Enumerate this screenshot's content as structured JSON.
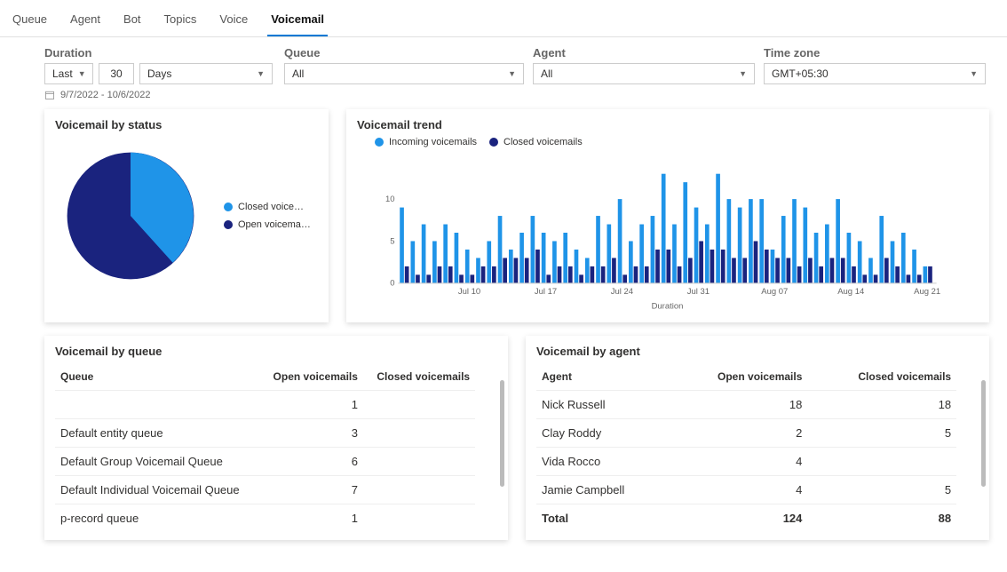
{
  "tabs": [
    "Queue",
    "Agent",
    "Bot",
    "Topics",
    "Voice",
    "Voicemail"
  ],
  "active_tab": 5,
  "filters": {
    "duration": {
      "label": "Duration",
      "mode": "Last",
      "value": "30",
      "unit": "Days"
    },
    "queue": {
      "label": "Queue",
      "value": "All"
    },
    "agent": {
      "label": "Agent",
      "value": "All"
    },
    "timezone": {
      "label": "Time zone",
      "value": "GMT+05:30"
    },
    "date_range": "9/7/2022 - 10/6/2022"
  },
  "pie": {
    "title": "Voicemail by status",
    "legend": {
      "closed": "Closed voice…",
      "open": "Open voicema…"
    }
  },
  "trend": {
    "title": "Voicemail trend",
    "legend": {
      "incoming": "Incoming voicemails",
      "closed": "Closed voicemails"
    },
    "xlabel": "Duration"
  },
  "queue_card": {
    "title": "Voicemail by queue",
    "cols": {
      "queue": "Queue",
      "open": "Open voicemails",
      "closed": "Closed voicemails"
    },
    "rows": [
      {
        "queue": "",
        "open": "1",
        "closed": ""
      },
      {
        "queue": "Default entity queue",
        "open": "3",
        "closed": ""
      },
      {
        "queue": "Default Group Voicemail Queue",
        "open": "6",
        "closed": ""
      },
      {
        "queue": "Default Individual Voicemail Queue",
        "open": "7",
        "closed": ""
      },
      {
        "queue": "p-record queue",
        "open": "1",
        "closed": ""
      }
    ]
  },
  "agent_card": {
    "title": "Voicemail by agent",
    "cols": {
      "agent": "Agent",
      "open": "Open voicemails",
      "closed": "Closed voicemails"
    },
    "rows": [
      {
        "agent": "Nick Russell",
        "open": "18",
        "closed": "18"
      },
      {
        "agent": "Clay Roddy",
        "open": "2",
        "closed": "5"
      },
      {
        "agent": "Vida Rocco",
        "open": "4",
        "closed": ""
      },
      {
        "agent": "Jamie Campbell",
        "open": "4",
        "closed": "5"
      }
    ],
    "total": {
      "label": "Total",
      "open": "124",
      "closed": "88"
    }
  },
  "chart_data": [
    {
      "type": "pie",
      "title": "Voicemail by status",
      "series": [
        {
          "name": "Closed voicemails",
          "value": 41,
          "color": "#1f94e8"
        },
        {
          "name": "Open voicemails",
          "value": 59,
          "color": "#1a237e"
        }
      ]
    },
    {
      "type": "bar",
      "title": "Voicemail trend",
      "xlabel": "Duration",
      "ylabel": "",
      "ylim": [
        0,
        14
      ],
      "yticks": [
        0,
        5,
        10
      ],
      "categories": [
        "Jul 04",
        "Jul 05",
        "Jul 06",
        "Jul 07",
        "Jul 08",
        "Jul 09",
        "Jul 10",
        "Jul 11",
        "Jul 12",
        "Jul 13",
        "Jul 14",
        "Jul 15",
        "Jul 16",
        "Jul 17",
        "Jul 18",
        "Jul 19",
        "Jul 20",
        "Jul 21",
        "Jul 22",
        "Jul 23",
        "Jul 24",
        "Jul 25",
        "Jul 26",
        "Jul 27",
        "Jul 28",
        "Jul 29",
        "Jul 30",
        "Jul 31",
        "Aug 01",
        "Aug 02",
        "Aug 03",
        "Aug 04",
        "Aug 05",
        "Aug 06",
        "Aug 07",
        "Aug 08",
        "Aug 09",
        "Aug 10",
        "Aug 11",
        "Aug 12",
        "Aug 13",
        "Aug 14",
        "Aug 15",
        "Aug 16",
        "Aug 17",
        "Aug 18",
        "Aug 19",
        "Aug 20",
        "Aug 21"
      ],
      "xticks": [
        "Jul 10",
        "Jul 17",
        "Jul 24",
        "Jul 31",
        "Aug 07",
        "Aug 14",
        "Aug 21"
      ],
      "series": [
        {
          "name": "Incoming voicemails",
          "color": "#1f94e8",
          "values": [
            9,
            5,
            7,
            5,
            7,
            6,
            4,
            3,
            5,
            8,
            4,
            6,
            8,
            6,
            5,
            6,
            4,
            3,
            8,
            7,
            10,
            5,
            7,
            8,
            13,
            7,
            12,
            9,
            7,
            13,
            10,
            9,
            10,
            10,
            4,
            8,
            10,
            9,
            6,
            7,
            10,
            6,
            5,
            3,
            8,
            5,
            6,
            4,
            2
          ]
        },
        {
          "name": "Closed voicemails",
          "color": "#1a237e",
          "values": [
            2,
            1,
            1,
            2,
            2,
            1,
            1,
            2,
            2,
            3,
            3,
            3,
            4,
            1,
            2,
            2,
            1,
            2,
            2,
            3,
            1,
            2,
            2,
            4,
            4,
            2,
            3,
            5,
            4,
            4,
            3,
            3,
            5,
            4,
            3,
            3,
            2,
            3,
            2,
            3,
            3,
            2,
            1,
            1,
            3,
            2,
            1,
            1,
            2
          ]
        }
      ]
    }
  ]
}
